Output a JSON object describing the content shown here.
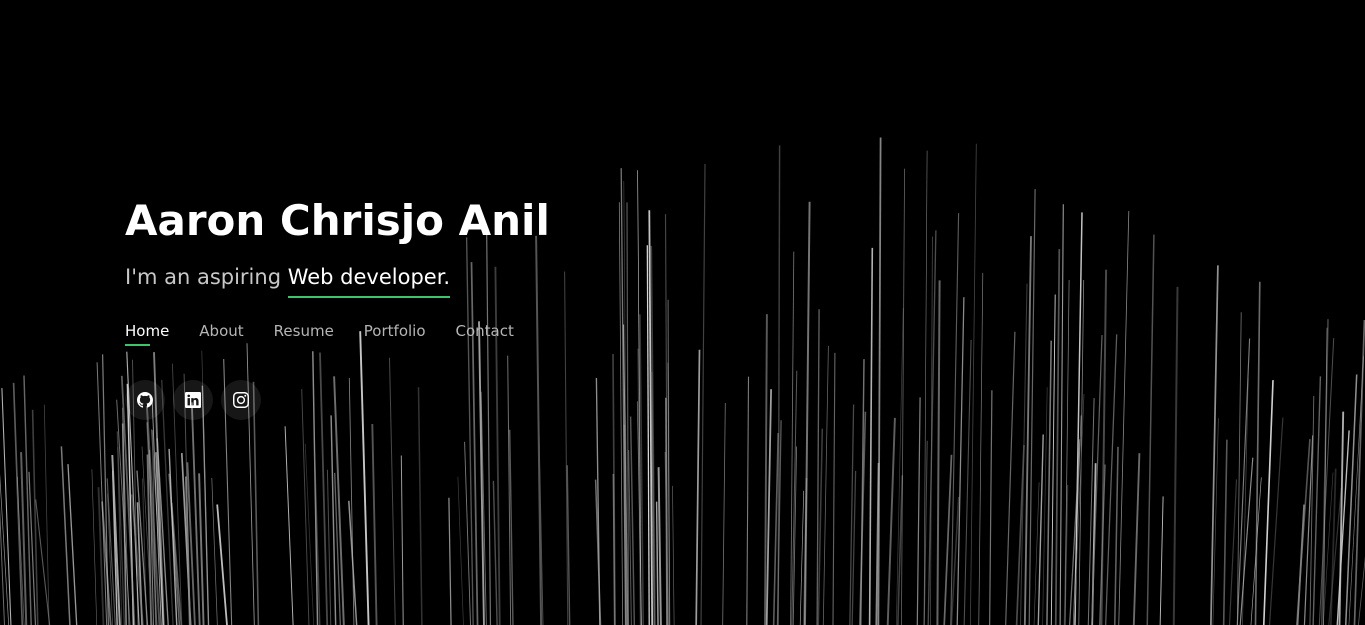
{
  "hero": {
    "name": "Aaron Chrisjo Anil",
    "tagline_prefix": "I'm an aspiring ",
    "tagline_typed": "Web developer."
  },
  "nav": {
    "items": [
      "Home",
      "About",
      "Resume",
      "Portfolio",
      "Contact"
    ],
    "active": "Home"
  },
  "social": {
    "icons": [
      "github-icon",
      "linkedin-icon",
      "instagram-icon"
    ]
  },
  "colors": {
    "background": "#000000",
    "accent": "#3ec46d",
    "text": "#ffffff",
    "muted": "#b5b5b5"
  }
}
